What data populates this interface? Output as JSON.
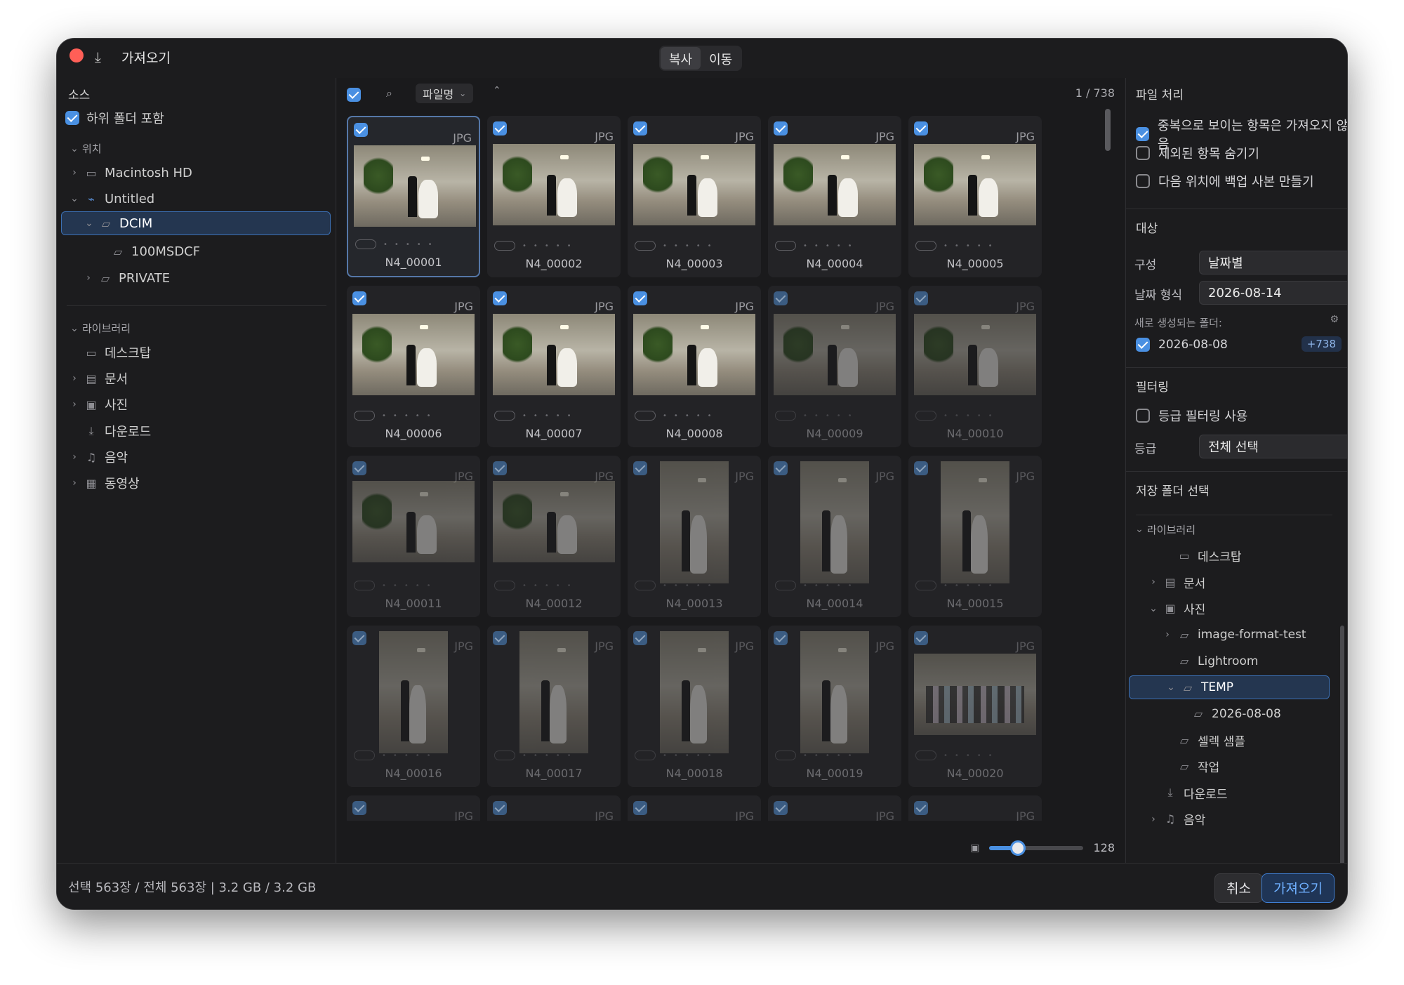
{
  "window": {
    "title": "가져오기",
    "mode_tabs": [
      "복사",
      "이동"
    ],
    "active_mode": "복사"
  },
  "source": {
    "title": "소스",
    "include_subfolders": {
      "label": "하위 폴더 포함",
      "checked": true
    },
    "location_group": "위치",
    "locations": [
      {
        "label": "Macintosh HD",
        "icon": "drive-icon"
      },
      {
        "label": "Untitled",
        "icon": "external-drive-icon"
      },
      {
        "label": "DCIM",
        "icon": "folder-icon"
      },
      {
        "label": "100MSDCF",
        "icon": "folder-icon"
      },
      {
        "label": "PRIVATE",
        "icon": "folder-icon"
      }
    ],
    "library_group": "라이브러리",
    "library": [
      {
        "label": "데스크탑",
        "icon": "desktop-icon"
      },
      {
        "label": "문서",
        "icon": "document-icon"
      },
      {
        "label": "사진",
        "icon": "photo-icon"
      },
      {
        "label": "다운로드",
        "icon": "download-icon"
      },
      {
        "label": "음악",
        "icon": "music-icon"
      },
      {
        "label": "동영상",
        "icon": "film-icon"
      }
    ]
  },
  "browser": {
    "sort_label": "파일명",
    "counter": "1 / 738",
    "thumb_size": "128",
    "thumb_scale": 0.3,
    "photos": [
      {
        "name": "N4_00001",
        "fmt": "JPG",
        "checked": true
      },
      {
        "name": "N4_00002",
        "fmt": "JPG",
        "checked": true
      },
      {
        "name": "N4_00003",
        "fmt": "JPG",
        "checked": true
      },
      {
        "name": "N4_00004",
        "fmt": "JPG",
        "checked": true
      },
      {
        "name": "N4_00005",
        "fmt": "JPG",
        "checked": true
      },
      {
        "name": "N4_00006",
        "fmt": "JPG",
        "checked": true
      },
      {
        "name": "N4_00007",
        "fmt": "JPG",
        "checked": true
      },
      {
        "name": "N4_00008",
        "fmt": "JPG",
        "checked": true
      },
      {
        "name": "N4_00009",
        "fmt": "JPG",
        "checked": true
      },
      {
        "name": "N4_00010",
        "fmt": "JPG",
        "checked": true
      },
      {
        "name": "N4_00011",
        "fmt": "JPG",
        "checked": true
      },
      {
        "name": "N4_00012",
        "fmt": "JPG",
        "checked": true
      },
      {
        "name": "N4_00013",
        "fmt": "JPG",
        "checked": true
      },
      {
        "name": "N4_00014",
        "fmt": "JPG",
        "checked": true
      },
      {
        "name": "N4_00015",
        "fmt": "JPG",
        "checked": true
      },
      {
        "name": "N4_00016",
        "fmt": "JPG",
        "checked": true
      },
      {
        "name": "N4_00017",
        "fmt": "JPG",
        "checked": true
      },
      {
        "name": "N4_00018",
        "fmt": "JPG",
        "checked": true
      },
      {
        "name": "N4_00019",
        "fmt": "JPG",
        "checked": true
      },
      {
        "name": "N4_00020",
        "fmt": "JPG",
        "checked": true
      },
      {
        "name": "",
        "fmt": "JPG",
        "checked": true
      },
      {
        "name": "",
        "fmt": "JPG",
        "checked": true
      },
      {
        "name": "",
        "fmt": "JPG",
        "checked": true
      },
      {
        "name": "",
        "fmt": "JPG",
        "checked": true
      },
      {
        "name": "",
        "fmt": "JPG",
        "checked": true
      }
    ]
  },
  "file_handling": {
    "title": "파일 처리",
    "options": [
      {
        "label": "중복으로 보이는 항목은 가져오지 않음",
        "checked": true
      },
      {
        "label": "제외된 항목 숨기기",
        "checked": false
      },
      {
        "label": "다음 위치에 백업 사본 만들기",
        "checked": false
      }
    ]
  },
  "destination": {
    "title": "대상",
    "organize_label": "구성",
    "organize_value": "날짜별",
    "date_format_label": "날짜 형식",
    "date_format_value": "2026-08-14",
    "new_folders_label": "새로 생성되는 폴더:",
    "new_folder": "2026-08-08",
    "new_folder_count": "+738"
  },
  "filtering": {
    "title": "필터링",
    "rating_filter_label": "등급 필터링 사용",
    "rating_label": "등급",
    "rating_value": "전체 선택"
  },
  "save_folder": {
    "title": "저장 폴더 선택",
    "tree": [
      {
        "label": "라이브러리",
        "icon": "",
        "chevron": "down"
      },
      {
        "label": "데스크탑",
        "icon": "desktop-icon",
        "chevron": ""
      },
      {
        "label": "문서",
        "icon": "document-icon",
        "chevron": "right"
      },
      {
        "label": "사진",
        "icon": "photo-icon",
        "chevron": "down"
      },
      {
        "label": "image-format-test",
        "icon": "folder-icon",
        "chevron": "right"
      },
      {
        "label": "Lightroom",
        "icon": "folder-icon",
        "chevron": ""
      },
      {
        "label": "TEMP",
        "icon": "folder-icon",
        "chevron": "down"
      },
      {
        "label": "2026-08-08",
        "icon": "folder-icon",
        "chevron": ""
      },
      {
        "label": "셀렉 샘플",
        "icon": "folder-icon",
        "chevron": ""
      },
      {
        "label": "작업",
        "icon": "folder-icon",
        "chevron": ""
      },
      {
        "label": "다운로드",
        "icon": "download-icon",
        "chevron": ""
      },
      {
        "label": "음악",
        "icon": "music-icon",
        "chevron": "right"
      }
    ]
  },
  "footer": {
    "status": "선택 563장 / 전체 563장  |  3.2 GB / 3.2 GB",
    "cancel": "취소",
    "import": "가져오기"
  }
}
